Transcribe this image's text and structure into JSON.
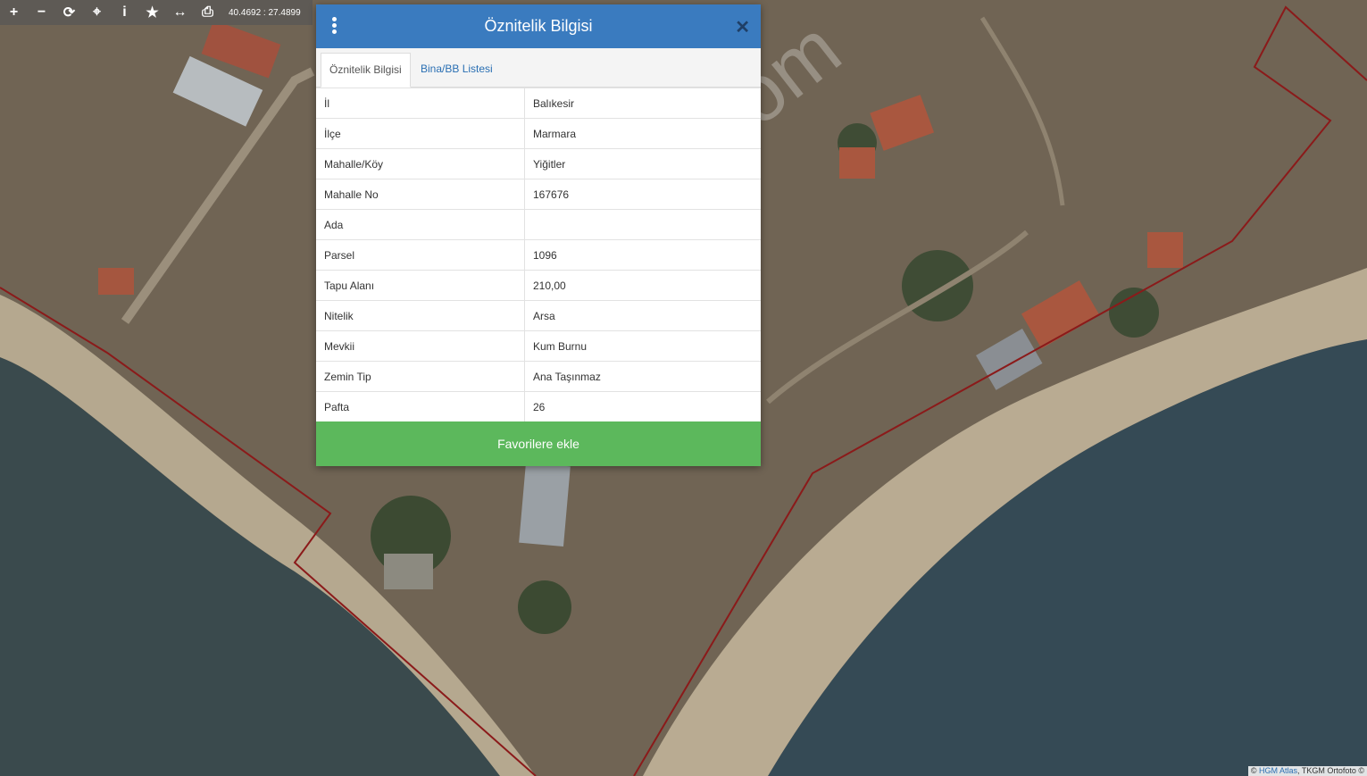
{
  "toolbar": {
    "buttons": [
      {
        "name": "zoom-in-icon",
        "glyph": "+"
      },
      {
        "name": "zoom-out-icon",
        "glyph": "−"
      },
      {
        "name": "refresh-icon",
        "glyph": "⟳"
      },
      {
        "name": "locate-icon",
        "glyph": "⌖"
      },
      {
        "name": "info-icon",
        "glyph": "i"
      },
      {
        "name": "star-icon",
        "glyph": "★"
      },
      {
        "name": "measure-icon",
        "glyph": "↔"
      },
      {
        "name": "print-icon",
        "glyph": "⎙"
      }
    ],
    "coordinates": "40.4692 : 27.4899"
  },
  "dialog": {
    "title": "Öznitelik Bilgisi",
    "tabs": [
      "Öznitelik Bilgisi",
      "Bina/BB Listesi"
    ],
    "rows": [
      {
        "key": "İl",
        "value": "Balıkesir"
      },
      {
        "key": "İlçe",
        "value": "Marmara"
      },
      {
        "key": "Mahalle/Köy",
        "value": "Yiğitler"
      },
      {
        "key": "Mahalle No",
        "value": "167676"
      },
      {
        "key": "Ada",
        "value": ""
      },
      {
        "key": "Parsel",
        "value": "1096"
      },
      {
        "key": "Tapu Alanı",
        "value": "210,00"
      },
      {
        "key": "Nitelik",
        "value": "Arsa"
      },
      {
        "key": "Mevkii",
        "value": "Kum Burnu"
      },
      {
        "key": "Zemin Tip",
        "value": "Ana Taşınmaz"
      },
      {
        "key": "Pafta",
        "value": "26"
      }
    ],
    "favorite_label": "Favorilere ekle"
  },
  "watermark": "emlakjet.com",
  "attribution": {
    "prefix": "© ",
    "link": "HGM Atlas",
    "suffix": ", TKGM Ortofoto ©"
  },
  "colors": {
    "header": "#3a7bbf",
    "favorite": "#5cb85c",
    "parcel_line": "#8b1a1a"
  }
}
